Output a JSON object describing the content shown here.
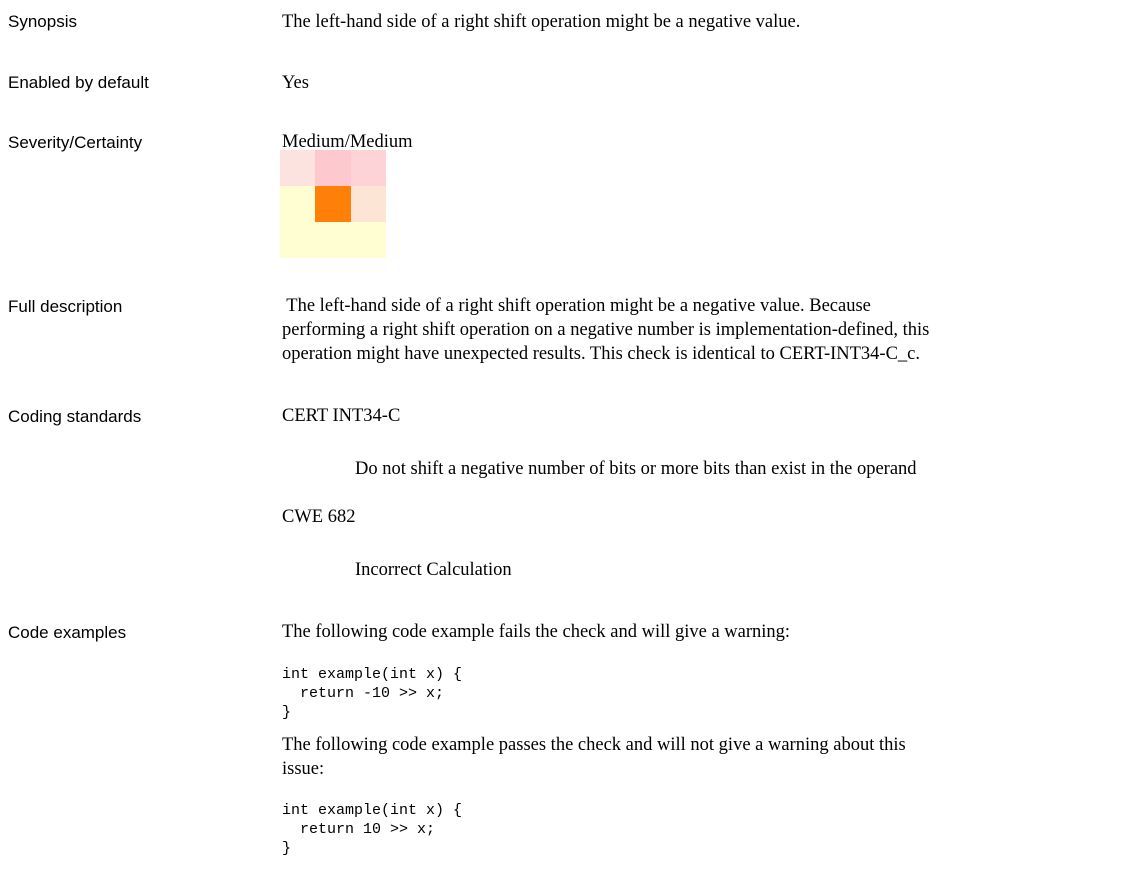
{
  "rows": {
    "synopsis": {
      "label": "Synopsis",
      "text": "The left-hand side of a right shift operation might be a negative value."
    },
    "enabled": {
      "label": "Enabled by default",
      "text": "Yes"
    },
    "severity": {
      "label": "Severity/Certainty",
      "text": "Medium/Medium",
      "grid_colors": [
        [
          "#fde3df",
          "#fdc9cf",
          "#fdd3d7"
        ],
        [
          "#fffdd2",
          "#ff8008",
          "#fde5d6"
        ],
        [
          "#fffdd2",
          "#fffdd2",
          "#fffdd2"
        ]
      ]
    },
    "description": {
      "label": "Full description",
      "lines": [
        " The left-hand side of a right shift operation might be a negative value. Because",
        "performing a right shift operation on a negative number is implementation-defined, this",
        "operation might have unexpected results. This check is identical to CERT-INT34-C_c."
      ]
    },
    "standards": {
      "label": "Coding standards",
      "items": [
        {
          "name": "CERT INT34-C",
          "detail": "Do not shift a negative number of bits or more bits than exist in the operand"
        },
        {
          "name": "CWE 682",
          "detail": "Incorrect Calculation"
        }
      ]
    },
    "examples": {
      "label": "Code examples",
      "fail_intro": "The following code example fails the check and will give a warning:",
      "fail_code": "int example(int x) {\n  return -10 >> x;\n}",
      "pass_intro_lines": [
        "The following code example passes the check and will not give a warning about this",
        "issue:"
      ],
      "pass_code": "int example(int x) {\n  return 10 >> x;\n}"
    }
  }
}
